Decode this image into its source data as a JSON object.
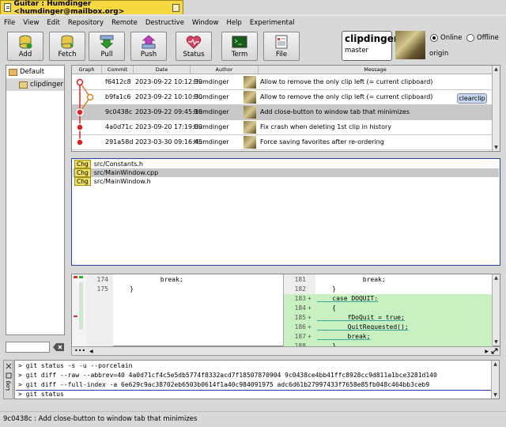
{
  "window": {
    "title": "Guitar : Humdinger <humdinger@mailbox.org>"
  },
  "menu": [
    "File",
    "View",
    "Edit",
    "Repository",
    "Remote",
    "Destructive",
    "Window",
    "Help",
    "Experimental"
  ],
  "toolbar": {
    "add": "Add",
    "fetch": "Fetch",
    "pull": "Pull",
    "push": "Push",
    "status": "Status",
    "term": "Term",
    "file": "File"
  },
  "repo": {
    "name": "clipdinger",
    "branch": "master",
    "remote": "origin"
  },
  "network": {
    "online": "Online",
    "offline": "Offline",
    "selected": "Online"
  },
  "sidebar": {
    "group": "Default",
    "item": "clipdinger"
  },
  "log": {
    "headers": {
      "graph": "Graph",
      "commit": "Commit",
      "date": "Date",
      "author": "Author",
      "message": "Message"
    },
    "rows": [
      {
        "commit": "f6412c8",
        "date": "2023-09-22 10:12:39",
        "author": "Humdinger",
        "message": "Allow to remove the only clip left (= current clipboard)"
      },
      {
        "commit": "b9fa1c6",
        "date": "2023-09-22 10:10:30",
        "author": "Humdinger",
        "message": "Allow to remove the only clip left (= current clipboard)"
      },
      {
        "commit": "9c0438c",
        "date": "2023-09-22 09:45:18",
        "author": "Humdinger",
        "message": "Add close-button to window tab that minimizes"
      },
      {
        "commit": "4a0d71c",
        "date": "2023-09-20 17:19:09",
        "author": "Humdinger",
        "message": "Fix crash when deleting 1st clip in history"
      },
      {
        "commit": "291a58d",
        "date": "2023-03-30 09:16:45",
        "author": "Humdinger",
        "message": "Force saving favorites after re-ordering"
      }
    ],
    "tag": "clearclip"
  },
  "files": [
    {
      "status": "Chg",
      "path": "src/Constants.h"
    },
    {
      "status": "Chg",
      "path": "src/MainWindow.cpp"
    },
    {
      "status": "Chg",
      "path": "src/MainWindow.h"
    }
  ],
  "diff": {
    "left": [
      {
        "num": "174",
        "code": "            break;"
      },
      {
        "num": "175",
        "code": "    }"
      }
    ],
    "right": [
      {
        "num": "181",
        "code": "            break;",
        "mark": ""
      },
      {
        "num": "182",
        "code": "    }",
        "mark": ""
      },
      {
        "num": "183",
        "code": "    case DOQUIT:",
        "mark": "+"
      },
      {
        "num": "184",
        "code": "    {",
        "mark": "+"
      },
      {
        "num": "185",
        "code": "        fDoQuit = true;",
        "mark": "+"
      },
      {
        "num": "186",
        "code": "        QuitRequested();",
        "mark": "+"
      },
      {
        "num": "187",
        "code": "        break;",
        "mark": "+"
      },
      {
        "num": "188",
        "code": "    }",
        "mark": "+"
      }
    ]
  },
  "console": {
    "lines": [
      "> git status -s -u --porcelain",
      "> git diff --raw --abbrev=40 4a0d71cf4c5e5db5774f8332acd7f18507870904 9c0438ce4bb41ffc8928cc9d811a1bce3281d140",
      "> git diff --full-index -a 6e629c9ac38702eb6503b0614f1a40c984091975 adc6d61b27997433f7658e85fb048c464bb3ceb9",
      "> git status"
    ],
    "side_label": "Log"
  },
  "status": "9c0438c : Add close-button to window tab that minimizes",
  "colors": {
    "tab": "#f5d840",
    "selection": "#c8c8c8",
    "added": "#c8f0c0",
    "graph": "#e02020",
    "focus": "#2a3fa8"
  }
}
